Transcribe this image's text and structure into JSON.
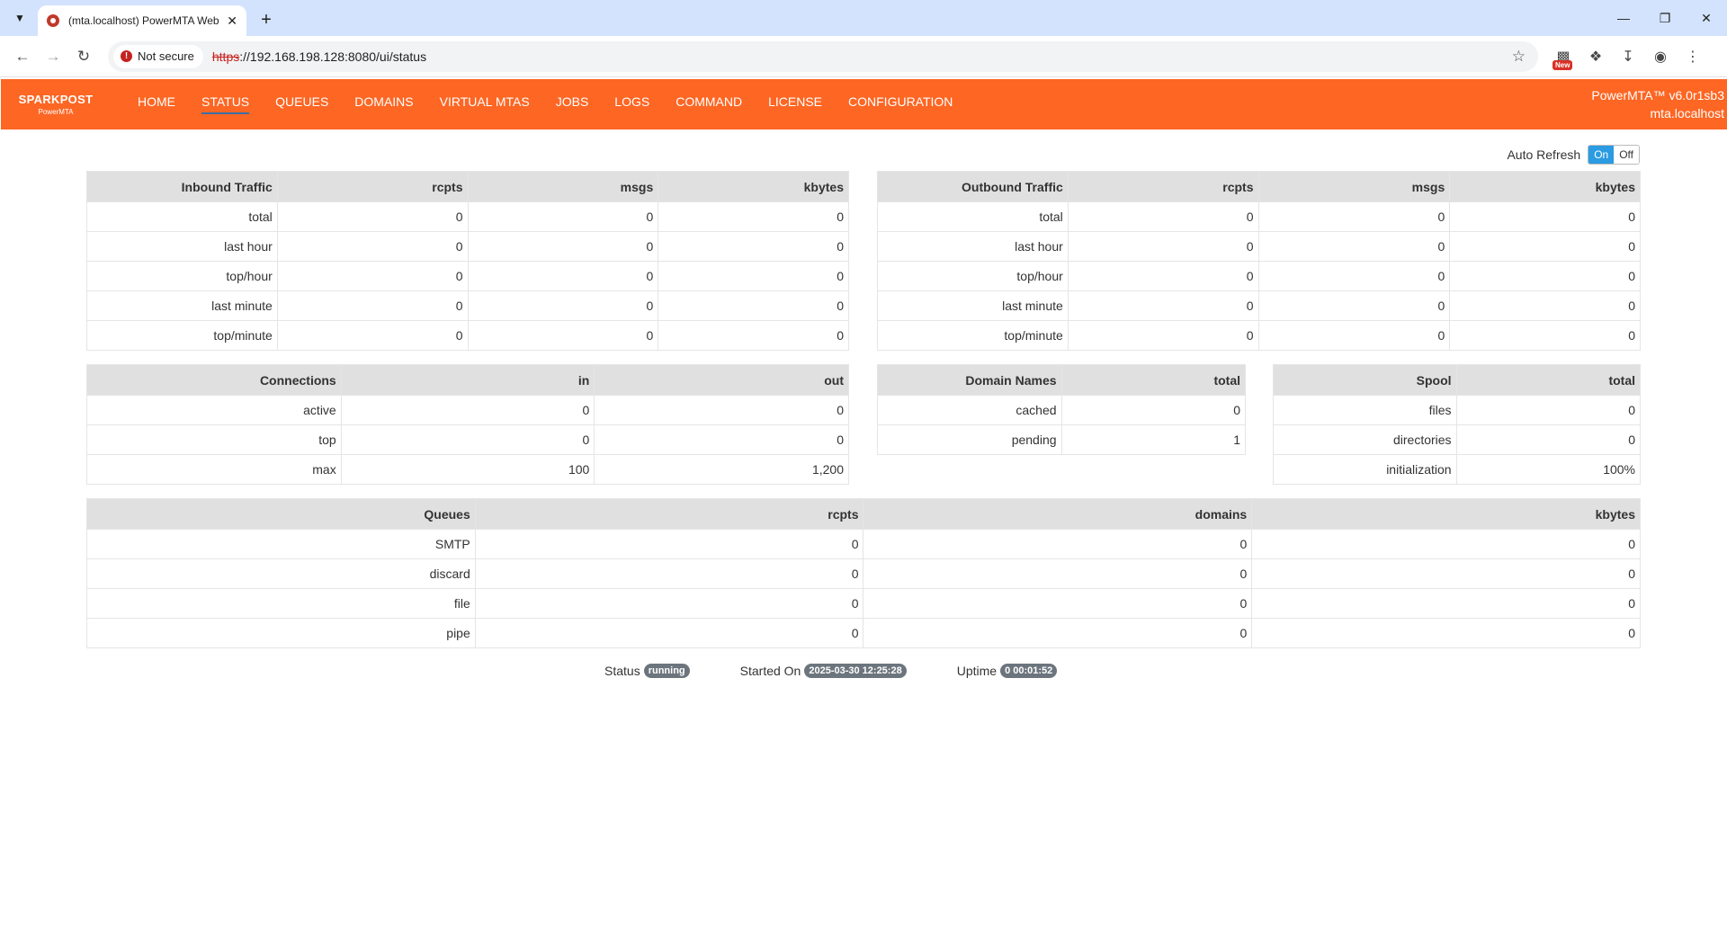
{
  "browser": {
    "tab_title": "(mta.localhost) PowerMTA Web",
    "not_secure": "Not secure",
    "url_proto": "https",
    "url_rest": "://192.168.198.128:8080/ui/status",
    "ext_new_badge": "New"
  },
  "app": {
    "logo_top": "SPARKPOST",
    "logo_bottom": "PowerMTA",
    "menu": [
      "HOME",
      "STATUS",
      "QUEUES",
      "DOMAINS",
      "VIRTUAL MTAS",
      "JOBS",
      "LOGS",
      "COMMAND",
      "LICENSE",
      "CONFIGURATION"
    ],
    "active_menu": "STATUS",
    "version": "PowerMTA™ v6.0r1sb3",
    "host": "mta.localhost"
  },
  "auto_refresh": {
    "label": "Auto Refresh",
    "on": "On",
    "off": "Off"
  },
  "inbound": {
    "headers": [
      "Inbound Traffic",
      "rcpts",
      "msgs",
      "kbytes"
    ],
    "rows": [
      [
        "total",
        "0",
        "0",
        "0"
      ],
      [
        "last hour",
        "0",
        "0",
        "0"
      ],
      [
        "top/hour",
        "0",
        "0",
        "0"
      ],
      [
        "last minute",
        "0",
        "0",
        "0"
      ],
      [
        "top/minute",
        "0",
        "0",
        "0"
      ]
    ]
  },
  "outbound": {
    "headers": [
      "Outbound Traffic",
      "rcpts",
      "msgs",
      "kbytes"
    ],
    "rows": [
      [
        "total",
        "0",
        "0",
        "0"
      ],
      [
        "last hour",
        "0",
        "0",
        "0"
      ],
      [
        "top/hour",
        "0",
        "0",
        "0"
      ],
      [
        "last minute",
        "0",
        "0",
        "0"
      ],
      [
        "top/minute",
        "0",
        "0",
        "0"
      ]
    ]
  },
  "connections": {
    "headers": [
      "Connections",
      "in",
      "out"
    ],
    "rows": [
      [
        "active",
        "0",
        "0"
      ],
      [
        "top",
        "0",
        "0"
      ],
      [
        "max",
        "100",
        "1,200"
      ]
    ]
  },
  "domain_names": {
    "headers": [
      "Domain Names",
      "total"
    ],
    "rows": [
      [
        "cached",
        "0"
      ],
      [
        "pending",
        "1"
      ]
    ]
  },
  "spool": {
    "headers": [
      "Spool",
      "total"
    ],
    "rows": [
      [
        "files",
        "0"
      ],
      [
        "directories",
        "0"
      ],
      [
        "initialization",
        "100%"
      ]
    ]
  },
  "queues": {
    "headers": [
      "Queues",
      "rcpts",
      "domains",
      "kbytes"
    ],
    "rows": [
      [
        "SMTP",
        "0",
        "0",
        "0"
      ],
      [
        "discard",
        "0",
        "0",
        "0"
      ],
      [
        "file",
        "0",
        "0",
        "0"
      ],
      [
        "pipe",
        "0",
        "0",
        "0"
      ]
    ]
  },
  "status": {
    "status_label": "Status",
    "status_value": "running",
    "started_label": "Started On",
    "started_value": "2025-03-30 12:25:28",
    "uptime_label": "Uptime",
    "uptime_value": "0 00:01:52"
  }
}
